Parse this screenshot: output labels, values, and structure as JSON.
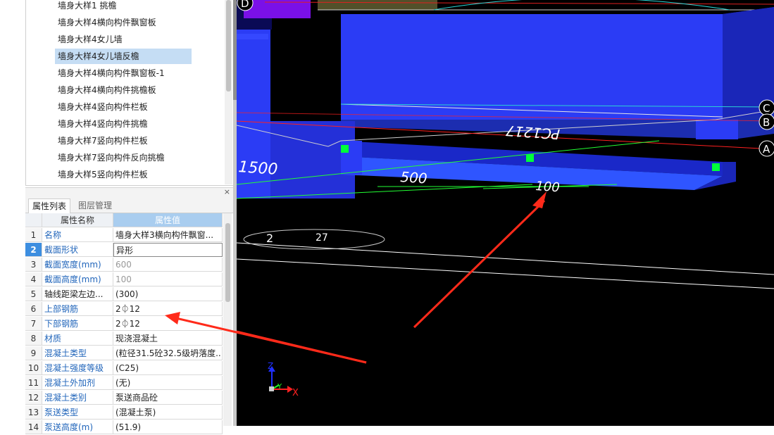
{
  "tree": {
    "items": [
      {
        "label": "墙身大样1 挑檐",
        "selected": false
      },
      {
        "label": "墙身大样4横向构件飘窗板",
        "selected": false
      },
      {
        "label": "墙身大样4女儿墙",
        "selected": false
      },
      {
        "label": "墙身大样4女儿墙反檐",
        "selected": true
      },
      {
        "label": "墙身大样4横向构件飘窗板-1",
        "selected": false
      },
      {
        "label": "墙身大样4横向构件挑檐板",
        "selected": false
      },
      {
        "label": "墙身大样4竖向构件栏板",
        "selected": false
      },
      {
        "label": "墙身大样4竖向构件挑檐",
        "selected": false
      },
      {
        "label": "墙身大样7竖向构件栏板",
        "selected": false
      },
      {
        "label": "墙身大样7竖向构件反向挑檐",
        "selected": false
      },
      {
        "label": "墙身大样5竖向构件栏板",
        "selected": false
      }
    ]
  },
  "panel": {
    "close_glyph": "×",
    "tabs": [
      "属性列表",
      "图层管理"
    ],
    "header": {
      "name": "属性名称",
      "value": "属性值"
    },
    "rows": [
      {
        "num": "1",
        "name": "名称",
        "value": "墙身大样3横向构件飘窗...",
        "name_style": "blue",
        "value_style": "black"
      },
      {
        "num": "2",
        "name": "截面形状",
        "value": "异形",
        "name_style": "blue",
        "value_style": "black",
        "selected": true
      },
      {
        "num": "3",
        "name": "截面宽度(mm)",
        "value": "600",
        "name_style": "blue",
        "value_style": "gray"
      },
      {
        "num": "4",
        "name": "截面高度(mm)",
        "value": "100",
        "name_style": "blue",
        "value_style": "gray"
      },
      {
        "num": "5",
        "name": "轴线距梁左边...",
        "value": "(300)",
        "name_style": "black",
        "value_style": "black"
      },
      {
        "num": "6",
        "name": "上部钢筋",
        "value": "2⏀12",
        "name_style": "blue",
        "value_style": "black"
      },
      {
        "num": "7",
        "name": "下部钢筋",
        "value": "2⏀12",
        "name_style": "blue",
        "value_style": "black"
      },
      {
        "num": "8",
        "name": "材质",
        "value": "现浇混凝土",
        "name_style": "blue",
        "value_style": "black"
      },
      {
        "num": "9",
        "name": "混凝土类型",
        "value": "(粒径31.5砼32.5级坍落度...",
        "name_style": "blue",
        "value_style": "black"
      },
      {
        "num": "10",
        "name": "混凝土强度等级",
        "value": "(C25)",
        "name_style": "blue",
        "value_style": "black"
      },
      {
        "num": "11",
        "name": "混凝土外加剂",
        "value": "(无)",
        "name_style": "blue",
        "value_style": "black"
      },
      {
        "num": "12",
        "name": "混凝土类别",
        "value": "泵送商品砼",
        "name_style": "blue",
        "value_style": "black"
      },
      {
        "num": "13",
        "name": "泵送类型",
        "value": "(混凝土泵)",
        "name_style": "blue",
        "value_style": "black"
      },
      {
        "num": "14",
        "name": "泵送高度(m)",
        "value": "(51.9)",
        "name_style": "blue",
        "value_style": "black"
      }
    ]
  },
  "viewport": {
    "axis_labels": {
      "d": "D",
      "c": "C",
      "b": "B",
      "a": "A"
    },
    "dimensions": {
      "d1": "1500",
      "d2": "500",
      "d3": "100",
      "circle": "27",
      "circle_prefix": "2"
    },
    "plan_text": "PC1217",
    "triad": {
      "z": "Z",
      "y": "Y",
      "x": "X"
    },
    "colors": {
      "slab": "#2b3cf5",
      "slab_side": "#1a26b8",
      "slab_top": "#3548ff",
      "grip": "#00ff3a",
      "arrow": "#ff2a1a",
      "dim": "#22ff33"
    }
  }
}
